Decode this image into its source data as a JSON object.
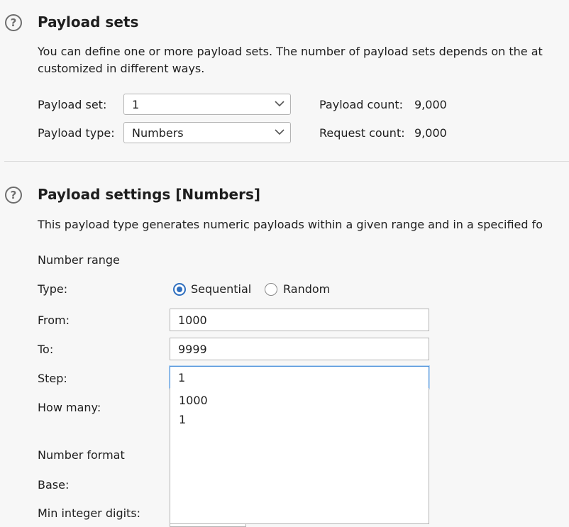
{
  "payload_sets": {
    "help_glyph": "?",
    "title": "Payload sets",
    "description_line1": "You can define one or more payload sets. The number of payload sets depends on the at",
    "description_line2": "customized in different ways.",
    "set_label": "Payload set:",
    "set_value": "1",
    "type_label": "Payload type:",
    "type_value": "Numbers",
    "payload_count_label": "Payload count:",
    "payload_count_value": "9,000",
    "request_count_label": "Request count:",
    "request_count_value": "9,000"
  },
  "payload_settings": {
    "help_glyph": "?",
    "title": "Payload settings [Numbers]",
    "description": "This payload type generates numeric payloads within a given range and in a specified fo",
    "number_range_label": "Number range",
    "type_label": "Type:",
    "sequential_label": "Sequential",
    "random_label": "Random",
    "selected_type": "Sequential",
    "from_label": "From:",
    "from_value": "1000",
    "to_label": "To:",
    "to_value": "9999",
    "step_label": "Step:",
    "step_value": "1",
    "how_many_label": "How many:",
    "autocomplete_options": [
      "1000",
      "1"
    ],
    "number_format_label": "Number format",
    "base_label": "Base:",
    "min_integer_digits_label": "Min integer digits:"
  },
  "colors": {
    "accent": "#2f6fbf",
    "focus_border": "#4a90d9",
    "background": "#f7f7f7"
  },
  "icons": {
    "help": "question-circle-icon",
    "dropdown": "chevron-down-icon"
  }
}
